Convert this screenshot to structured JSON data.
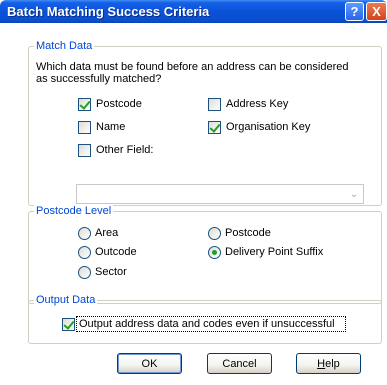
{
  "window": {
    "title": "Batch Matching Success Criteria",
    "help_glyph": "?",
    "close_glyph": "X"
  },
  "match_data": {
    "legend": "Match Data",
    "question_line1": "Which data must be found before an address can be considered",
    "question_line2": "as successfully matched?",
    "options": [
      {
        "label": "Postcode",
        "checked": true
      },
      {
        "label": "Address Key",
        "checked": false
      },
      {
        "label": "Name",
        "checked": false
      },
      {
        "label": "Organisation Key",
        "checked": true
      },
      {
        "label": "Other Field:",
        "checked": false
      }
    ],
    "other_field_value": ""
  },
  "postcode_level": {
    "legend": "Postcode Level",
    "options": [
      {
        "label": "Area",
        "selected": false
      },
      {
        "label": "Postcode",
        "selected": false
      },
      {
        "label": "Outcode",
        "selected": false
      },
      {
        "label": "Delivery Point Suffix",
        "selected": true
      },
      {
        "label": "Sector",
        "selected": false
      }
    ]
  },
  "output_data": {
    "legend": "Output Data",
    "option_label": "Output address data and codes even if unsuccessful",
    "checked": true
  },
  "buttons": {
    "ok": "OK",
    "cancel": "Cancel",
    "help_prefix": "",
    "help_mnemonic": "H",
    "help_rest": "elp"
  }
}
